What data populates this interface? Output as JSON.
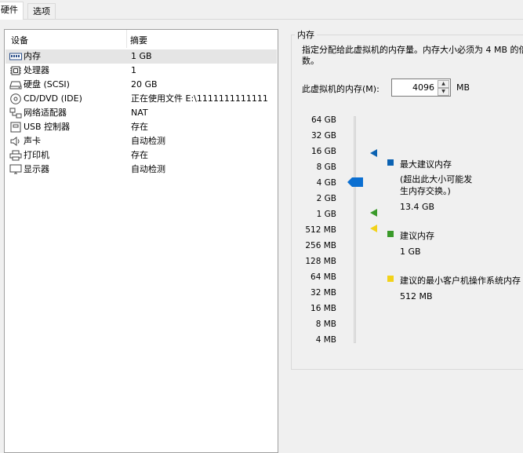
{
  "tabs": [
    {
      "label": "硬件"
    },
    {
      "label": "选项"
    }
  ],
  "device_list": {
    "headers": {
      "device": "设备",
      "summary": "摘要"
    },
    "items": [
      {
        "name": "内存",
        "summary": "1 GB",
        "icon": "memory-icon",
        "color": "#2b4f8a"
      },
      {
        "name": "处理器",
        "summary": "1",
        "icon": "cpu-icon",
        "color": "#333333"
      },
      {
        "name": "硬盘 (SCSI)",
        "summary": "20 GB",
        "icon": "hard-disk-icon",
        "color": "#444444"
      },
      {
        "name": "CD/DVD (IDE)",
        "summary": "正在使用文件 E:\\1111111111111",
        "icon": "cd-dvd-icon",
        "color": "#444444"
      },
      {
        "name": "网络适配器",
        "summary": "NAT",
        "icon": "network-adapter-icon",
        "color": "#444444"
      },
      {
        "name": "USB 控制器",
        "summary": "存在",
        "icon": "usb-icon",
        "color": "#444444"
      },
      {
        "name": "声卡",
        "summary": "自动检测",
        "icon": "speaker-icon",
        "color": "#444444"
      },
      {
        "name": "打印机",
        "summary": "存在",
        "icon": "printer-icon",
        "color": "#444444"
      },
      {
        "name": "显示器",
        "summary": "自动检测",
        "icon": "monitor-icon",
        "color": "#444444"
      }
    ]
  },
  "memory": {
    "group_title": "内存",
    "description": "指定分配给此虚拟机的内存量。内存大小必须为 4 MB 的倍数。",
    "field_label": "此虚拟机的内存(M):",
    "value": "4096",
    "unit": "MB",
    "scale": [
      "64 GB",
      "32 GB",
      "16 GB",
      "8 GB",
      "4 GB",
      "2 GB",
      "1 GB",
      "512 MB",
      "256 MB",
      "128 MB",
      "64 MB",
      "32 MB",
      "16 MB",
      "8 MB",
      "4 MB"
    ],
    "legend": {
      "max": {
        "title": "最大建议内存",
        "note": "(超出此大小可能发生内存交换。)",
        "value": "13.4 GB",
        "color": "#0b62b2"
      },
      "recommended": {
        "title": "建议内存",
        "value": "1 GB",
        "color": "#3a9a2a"
      },
      "min": {
        "title": "建议的最小客户机操作系统内存",
        "value": "512 MB",
        "color": "#f2d21a"
      }
    },
    "slider_color": "#0b6fd1"
  }
}
